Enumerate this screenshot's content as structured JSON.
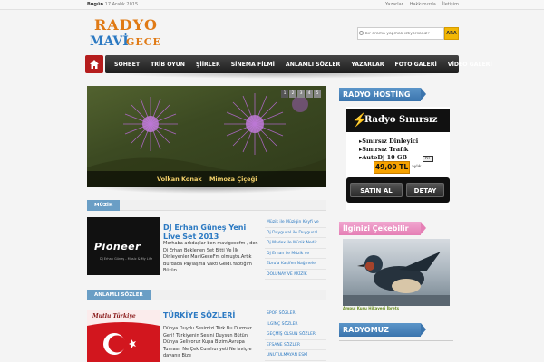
{
  "topbar": {
    "date_label": "Bugün",
    "date_value": "17 Aralık 2015",
    "links": [
      "Yazarlar",
      "Hakkımızda",
      "İletişim"
    ]
  },
  "logo": {
    "line1": "RADYO",
    "line2": "MAVİ",
    "line3": "GECE"
  },
  "search": {
    "placeholder": "bir arama yapmak istiyorsanız?",
    "button_label": "ARA"
  },
  "nav": {
    "items": [
      "SOHBET",
      "TRİB OYUN",
      "ŞİİRLER",
      "SİNEMA FİLMİ",
      "ANLAMLI SÖZLER",
      "YAZARLAR",
      "FOTO GALERİ",
      "VİDEO GALERİ"
    ]
  },
  "slider": {
    "caption_author": "Volkan Konak",
    "caption_title": "Mimoza Çiçeği",
    "pages": [
      "1",
      "2",
      "3",
      "4",
      "5"
    ]
  },
  "sections": [
    {
      "tab": "MÜZİK",
      "post_title": "DJ Erhan Güneş Yeni Live Set 2013",
      "post_text": "Merhaba arkdaşlar ben mavigecefm , den Dj Erhan Beklenen Set Bitti Ve İlk Dinleyenler MaviGeceFm olmuştu.Artık Burdada Paylaşma Vakti Geldi.Yaptığım Bütün",
      "image_brand": "Pioneer",
      "image_sub": "Dj Erhan Güneş - Music & My Life",
      "links": [
        "Müzik ile Müziğin Keyfi ve",
        "Dj Duygusal ile Duygusal",
        "Dj Madex ile Müzik Nedir",
        "Dj Erhan ile Müzik ve",
        "Ebru'a Kaşifen Nağmeler",
        "DOLUNAY VE MÜZİK"
      ]
    },
    {
      "tab": "ANLAMLI SÖZLER",
      "post_title": "TÜRKİYE SÖZLERİ",
      "post_text": "Dünya Duydu Sesimizi Türk Bu Durmaz Geri! Türkiyenin Sesini Duysun Bütün Dünya Geliyoruz Kupa Bizim Avrupa Turnası! Ne Çek Cumhuriyeti Ne isviçre dayanır Bize",
      "image_text": "Mutlu Türkiye",
      "links": [
        "SPOR SÖZLERİ",
        "İLGİNÇ SÖZLER",
        "GEÇMİŞ OLSUN SÖZLERİ",
        "EFSANE SÖZLER",
        "UNUTULMAYAN ESKİ"
      ]
    }
  ],
  "sidebar": {
    "hosting_title": "RADYO HOSTİNG",
    "host_brand": "Radyo Sınırsız",
    "host_features": [
      "Sınırsız Dinleyici",
      "Sınırsız Trafik",
      "AutoDj 10 GB"
    ],
    "host_badge": "RT",
    "host_price": "49,00 TL",
    "host_period": "aylık",
    "buy_label": "SATIN AL",
    "detail_label": "DETAY",
    "photo_title": "İlginizi Çekebilir",
    "photo_caption": "Ampul Kuşu Hikayesi İbrets",
    "radyomuz_title": "RADYOMUZ"
  },
  "colors": {
    "accent_blue": "#2b79c2",
    "logo_orange": "#e07a15",
    "nav_dark": "#1e1e1e",
    "home_red": "#b51d1d",
    "tab_blue": "#6a9ec5",
    "price_orange": "#f6a200"
  }
}
